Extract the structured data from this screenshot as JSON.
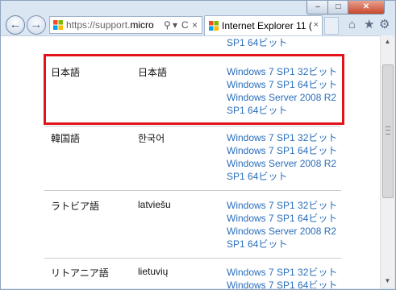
{
  "window": {
    "controls": {
      "minimize": "–",
      "maximize": "□",
      "close": "✕"
    }
  },
  "toolbar": {
    "back_icon": "←",
    "forward_icon": "→",
    "address": {
      "url_prefix": "https://support.",
      "url_domain": "micro",
      "search_icon": "⚲",
      "dropdown_icon": "▾",
      "refresh_icon": "C",
      "close_icon": "×"
    },
    "tab": {
      "title": "Internet Explorer 11 (...",
      "close": "×"
    },
    "icons": {
      "home": "⌂",
      "favorites": "★",
      "settings": "⚙"
    }
  },
  "table": {
    "top_partial_link": "SP1 64ビット",
    "rows": [
      {
        "language": "日本語",
        "native": "日本語",
        "links": [
          "Windows 7 SP1 32ビット",
          "Windows 7 SP1 64ビット",
          "Windows Server 2008 R2",
          "SP1 64ビット"
        ]
      },
      {
        "language": "韓国語",
        "native": "한국어",
        "links": [
          "Windows 7 SP1 32ビット",
          "Windows 7 SP1 64ビット",
          "Windows Server 2008 R2",
          "SP1 64ビット"
        ]
      },
      {
        "language": "ラトビア語",
        "native": "latviešu",
        "links": [
          "Windows 7 SP1 32ビット",
          "Windows 7 SP1 64ビット",
          "Windows Server 2008 R2",
          "SP1 64ビット"
        ]
      },
      {
        "language": "リトアニア語",
        "native": "lietuvių",
        "links": [
          "Windows 7 SP1 32ビット",
          "Windows 7 SP1 64ビット"
        ]
      }
    ]
  },
  "colors": {
    "highlight": "#e1121a",
    "link": "#2a6ebb"
  }
}
